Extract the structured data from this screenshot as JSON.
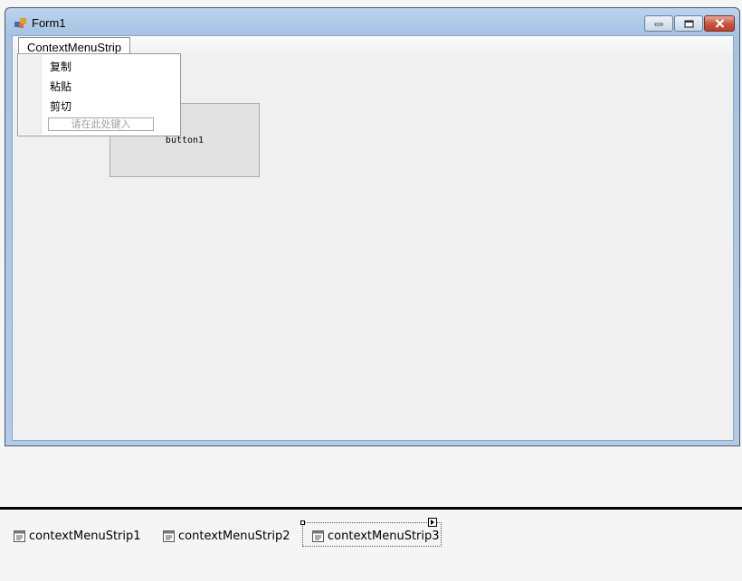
{
  "window": {
    "title": "Form1",
    "menustrip_item": "ContextMenuStrip",
    "button_text": "button1"
  },
  "context_menu": {
    "items": [
      "复制",
      "粘贴",
      "剪切"
    ],
    "type_here_placeholder": "请在此处键入"
  },
  "tray": {
    "components": [
      {
        "label": "contextMenuStrip1",
        "icon": "context-menu-icon"
      },
      {
        "label": "contextMenuStrip2",
        "icon": "context-menu-icon"
      },
      {
        "label": "contextMenuStrip3",
        "icon": "context-menu-icon"
      }
    ],
    "selected_index": 2
  },
  "colors": {
    "titlebar": "#b9d1ea",
    "close_button": "#c7513d",
    "client_bg": "#f0f0f0"
  }
}
